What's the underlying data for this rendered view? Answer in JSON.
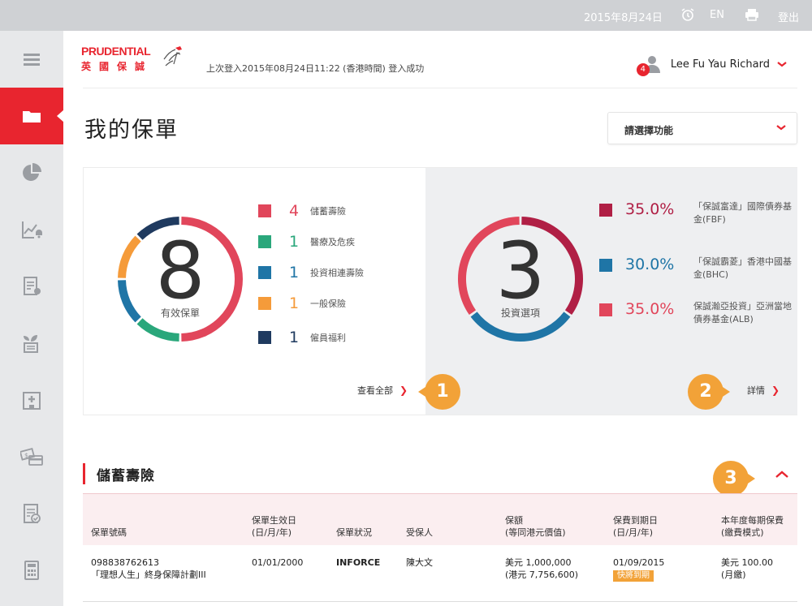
{
  "topbar": {
    "date": "2015年8月24日",
    "alarm_icon": "alarm-clock-icon",
    "language": "EN",
    "print_icon": "printer-icon",
    "logout": "登出"
  },
  "sidebar": {
    "items": [
      {
        "icon": "menu-icon",
        "active": false
      },
      {
        "icon": "folder-icon",
        "active": true
      },
      {
        "icon": "pie-chart-icon",
        "active": false
      },
      {
        "icon": "line-chart-bell-icon",
        "active": false
      },
      {
        "icon": "certificate-doc-icon",
        "active": false
      },
      {
        "icon": "plant-doc-icon",
        "active": false
      },
      {
        "icon": "hospital-icon",
        "active": false
      },
      {
        "icon": "money-card-icon",
        "active": false
      },
      {
        "icon": "checklist-doc-icon",
        "active": false
      },
      {
        "icon": "calculator-icon",
        "active": false
      }
    ]
  },
  "header": {
    "brand": "PRUDENTIAL",
    "brand_cn": "英國保誠",
    "last_login": "上次登入2015年08月24日11:22 (香港時間) 登入成功",
    "user_name": "Lee Fu Yau Richard",
    "notification_count": "4"
  },
  "page": {
    "title": "我的保單",
    "function_select": "請選擇功能"
  },
  "policies_summary": {
    "total": "8",
    "total_label": "有效保單",
    "view_all": "查看全部",
    "items": [
      {
        "count": "4",
        "label": "儲蓄壽險",
        "color": "#e1465b"
      },
      {
        "count": "1",
        "label": "醫療及危疾",
        "color": "#2aa77b"
      },
      {
        "count": "1",
        "label": "投資相連壽險",
        "color": "#1f75a6"
      },
      {
        "count": "1",
        "label": "一般保險",
        "color": "#f59b3a"
      },
      {
        "count": "1",
        "label": "僱員福利",
        "color": "#1f3a5f"
      }
    ]
  },
  "investment_summary": {
    "total": "3",
    "total_label": "投資選項",
    "details": "詳情",
    "funds": [
      {
        "pct": "35.0%",
        "name": "「保誠富達」國際債券基金(FBF)",
        "color": "#b01f45",
        "value": 35.0
      },
      {
        "pct": "30.0%",
        "name": "「保誠霸菱」香港中國基金(BHC)",
        "color": "#1f75a6",
        "value": 30.0
      },
      {
        "pct": "35.0%",
        "name": "保誠瀚亞投資」亞洲當地債券基金(ALB)",
        "color": "#e1465b",
        "value": 35.0
      }
    ]
  },
  "callouts": [
    "1",
    "2",
    "3"
  ],
  "section": {
    "title": "儲蓄壽險",
    "headers": {
      "policy_no": "保單號碼",
      "effective_date_1": "保單生效日",
      "effective_date_2": "(日/月/年)",
      "status": "保單狀況",
      "insured": "受保人",
      "sum_1": "保額",
      "sum_2": "(等同港元價值)",
      "due_1": "保費到期日",
      "due_2": "(日/月/年)",
      "premium_1": "本年度每期保費",
      "premium_2": "(繳費模式)"
    },
    "rows": [
      {
        "policy_no": "098838762613",
        "plan": "「理想人生」終身保障計劃III",
        "effective_date": "01/01/2000",
        "status": "INFORCE",
        "insured": "陳大文",
        "sum": "美元 1,000,000",
        "sum_hkd": "(港元 7,756,600)",
        "due_date": "01/09/2015",
        "due_tag": "快將到期",
        "premium": "美元 100.00",
        "mode": "(月繳)"
      }
    ]
  },
  "colors": {
    "accent": "#e8252f",
    "callout": "#f2a238"
  }
}
